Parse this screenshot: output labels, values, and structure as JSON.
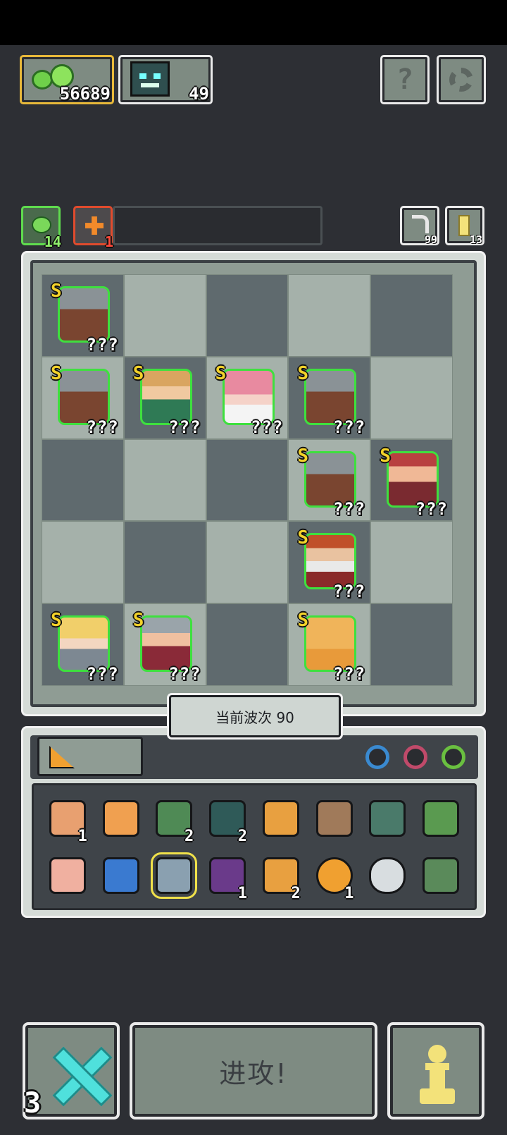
{
  "resources": {
    "gems": {
      "icon": "green-slime-icon",
      "value": "56689"
    },
    "monster_cards": {
      "icon": "monster-portrait-icon",
      "value": "49"
    }
  },
  "top_buttons": {
    "help_symbol": "?",
    "settings_icon": "gear-icon"
  },
  "secondary": {
    "slime_count": "14",
    "heal_count": "1",
    "undo_count": "99",
    "key_count": "13"
  },
  "board": {
    "wave_label": "当前波次 90",
    "units": [
      {
        "rank": "S",
        "stats": "???",
        "kind": "shield-knight-icon"
      },
      {
        "rank": "S",
        "stats": "???",
        "kind": "shield-knight-icon"
      },
      {
        "rank": "S",
        "stats": "???",
        "kind": "axe-warrior-icon"
      },
      {
        "rank": "S",
        "stats": "???",
        "kind": "pink-mage-icon"
      },
      {
        "rank": "S",
        "stats": "???",
        "kind": "shield-knight-icon"
      },
      {
        "rank": "S",
        "stats": "???",
        "kind": "shield-knight-icon"
      },
      {
        "rank": "S",
        "stats": "???",
        "kind": "red-brawler-icon"
      },
      {
        "rank": "S",
        "stats": "???",
        "kind": "bearded-king-icon"
      },
      {
        "rank": "S",
        "stats": "???",
        "kind": "blonde-rogue-icon"
      },
      {
        "rank": "S",
        "stats": "???",
        "kind": "spear-soldier-icon"
      },
      {
        "rank": "S",
        "stats": "???",
        "kind": "golden-golem-icon"
      }
    ]
  },
  "inventory": {
    "items": [
      {
        "icon": "trash-can-icon",
        "count": "1"
      },
      {
        "icon": "cat-badge-icon",
        "count": ""
      },
      {
        "icon": "orc-recruit-icon",
        "count": "2"
      },
      {
        "icon": "monster-card-icon",
        "count": "2"
      },
      {
        "icon": "claw-trident-icon",
        "count": ""
      },
      {
        "icon": "slingshot-icon",
        "count": ""
      },
      {
        "icon": "crystal-spikes-icon",
        "count": ""
      },
      {
        "icon": "treasure-chest-icon",
        "count": ""
      },
      {
        "icon": "eye-palm-icon",
        "count": ""
      },
      {
        "icon": "blue-wind-icon",
        "count": ""
      },
      {
        "icon": "ice-crystal-icon",
        "count": ""
      },
      {
        "icon": "demon-skull-icon",
        "count": "1"
      },
      {
        "icon": "sparkle-burst-icon",
        "count": "2"
      },
      {
        "icon": "gold-ring-icon",
        "count": "1"
      },
      {
        "icon": "mirror-icon",
        "count": ""
      },
      {
        "icon": "arrow-icon",
        "count": ""
      }
    ]
  },
  "bottom": {
    "attack_label": "进攻!",
    "cancel_count": "3",
    "cancel_icon": "cross-swords-icon",
    "pawn_icon": "pawn-icon"
  },
  "colors": {
    "frame": "#f2f2f2",
    "panel": "#7e8b82",
    "rank_s": "#f3d22a",
    "unit_glow": "#3ee03e"
  }
}
